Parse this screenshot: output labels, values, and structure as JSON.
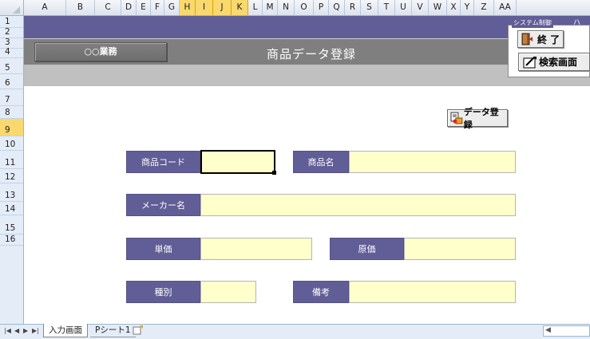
{
  "columns": [
    {
      "label": "A",
      "selected": false
    },
    {
      "label": "B",
      "selected": false
    },
    {
      "label": "C",
      "selected": false
    },
    {
      "label": "D",
      "selected": false
    },
    {
      "label": "E",
      "selected": false
    },
    {
      "label": "F",
      "selected": false
    },
    {
      "label": "G",
      "selected": false
    },
    {
      "label": "H",
      "selected": true
    },
    {
      "label": "I",
      "selected": true
    },
    {
      "label": "J",
      "selected": true
    },
    {
      "label": "K",
      "selected": true
    },
    {
      "label": "L",
      "selected": false
    },
    {
      "label": "M",
      "selected": false
    },
    {
      "label": "N",
      "selected": false
    },
    {
      "label": "O",
      "selected": false
    },
    {
      "label": "P",
      "selected": false
    },
    {
      "label": "Q",
      "selected": false
    },
    {
      "label": "R",
      "selected": false
    },
    {
      "label": "S",
      "selected": false
    },
    {
      "label": "T",
      "selected": false
    },
    {
      "label": "U",
      "selected": false
    },
    {
      "label": "V",
      "selected": false
    },
    {
      "label": "W",
      "selected": false
    },
    {
      "label": "X",
      "selected": false
    },
    {
      "label": "Y",
      "selected": false
    },
    {
      "label": "Z",
      "selected": false
    },
    {
      "label": "AA",
      "selected": false
    }
  ],
  "rows": [
    {
      "label": "1",
      "selected": false
    },
    {
      "label": "2",
      "selected": false
    },
    {
      "label": "3",
      "selected": false
    },
    {
      "label": "4",
      "selected": false
    },
    {
      "label": "5",
      "selected": false
    },
    {
      "label": "6",
      "selected": false
    },
    {
      "label": "7",
      "selected": false
    },
    {
      "label": "8",
      "selected": false
    },
    {
      "label": "9",
      "selected": true
    },
    {
      "label": "10",
      "selected": false
    },
    {
      "label": "11",
      "selected": false
    },
    {
      "label": "12",
      "selected": false
    },
    {
      "label": "13",
      "selected": false
    },
    {
      "label": "14",
      "selected": false
    },
    {
      "label": "15",
      "selected": false
    },
    {
      "label": "16",
      "selected": false
    }
  ],
  "header": {
    "title": "商品データ登録",
    "department": "○○業務"
  },
  "system_control": {
    "group_label": "システム制御",
    "extra_label": "ハ",
    "exit_label": "終 了",
    "search_label": "検索画面"
  },
  "register_button_label": "データ登録",
  "form": {
    "product_code_label": "商品コード",
    "product_name_label": "商品名",
    "maker_name_label": "メーカー名",
    "unit_price_label": "単価",
    "cost_price_label": "原価",
    "category_label": "種別",
    "remarks_label": "備考",
    "product_code_value": "",
    "product_name_value": "",
    "maker_name_value": "",
    "unit_price_value": "",
    "cost_price_value": "",
    "category_value": "",
    "remarks_value": ""
  },
  "sheet_tabs": {
    "tab1": "入力画面",
    "tab2": "Pシート1"
  },
  "colors": {
    "header_purple": "#615d96",
    "input_yellow": "#ffffcc",
    "selection_orange": "#f9d86d"
  }
}
